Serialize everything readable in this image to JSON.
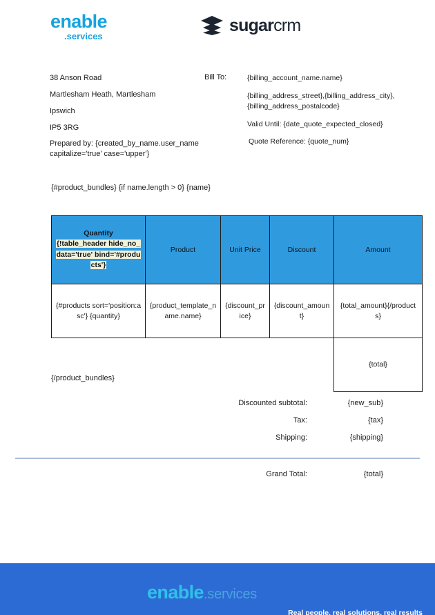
{
  "header": {
    "enable_logo": {
      "word_main": "enable",
      "word_sub": ".services",
      "icon": "enable-services-logo"
    },
    "sugar_logo": {
      "word_bold": "sugar",
      "word_light": "crm",
      "icon": "sugarcrm-stacked-layers-icon"
    }
  },
  "sender": {
    "lines": [
      "38 Anson Road",
      "Martlesham Heath, Martlesham",
      "Ipswich",
      "IP5 3RG"
    ],
    "prepared_by": "Prepared by: {created_by_name.user_name capitalize='true' case='upper'}"
  },
  "bill_to": {
    "label": "Bill To:",
    "account_name": "{billing_account_name.name}",
    "address": "{billing_address_street},{billing_address_city}, {billing_address_postalcode}",
    "valid_until": "Valid Until: {date_quote_expected_closed}",
    "quote_reference": "Quote Reference: {quote_num}"
  },
  "bundle": {
    "open_tag": "{#product_bundles} {if name.length > 0} {name}",
    "close_tag": "{/product_bundles}"
  },
  "table": {
    "headers": {
      "quantity_title": "Quantity",
      "quantity_directive": "{!table_header hide_no_data='true' bind='#products'}",
      "product": "Product",
      "unit_price": "Unit Price",
      "discount": "Discount",
      "amount": "Amount"
    },
    "row": {
      "quantity": "{#products sort='position:asc'} {quantity}",
      "product": "{product_template_name.name}",
      "unit_price": "{discount_price}",
      "discount": "{discount_amount}",
      "amount": "{total_amount}{/products}"
    },
    "total_cell": "{total}"
  },
  "totals": {
    "rows": [
      {
        "label": "Discounted subtotal:",
        "value": "{new_sub}"
      },
      {
        "label": "Tax:",
        "value": "{tax}"
      },
      {
        "label": "Shipping:",
        "value": "{shipping}"
      }
    ],
    "grand_total": {
      "label": "Grand Total:",
      "value": "{total}"
    }
  },
  "footer": {
    "logo_main": "enable",
    "logo_sub": ".services",
    "tagline": "Real people, real solutions, real results",
    "background_color": "#2d6bd4",
    "logo_color": "#2ec2e8"
  },
  "colors": {
    "table_header_blue": "#2f9ade",
    "brand_blue": "#17a3e0",
    "highlight_cream": "#f1f2d9",
    "divider_blue": "#a9bcdb"
  }
}
